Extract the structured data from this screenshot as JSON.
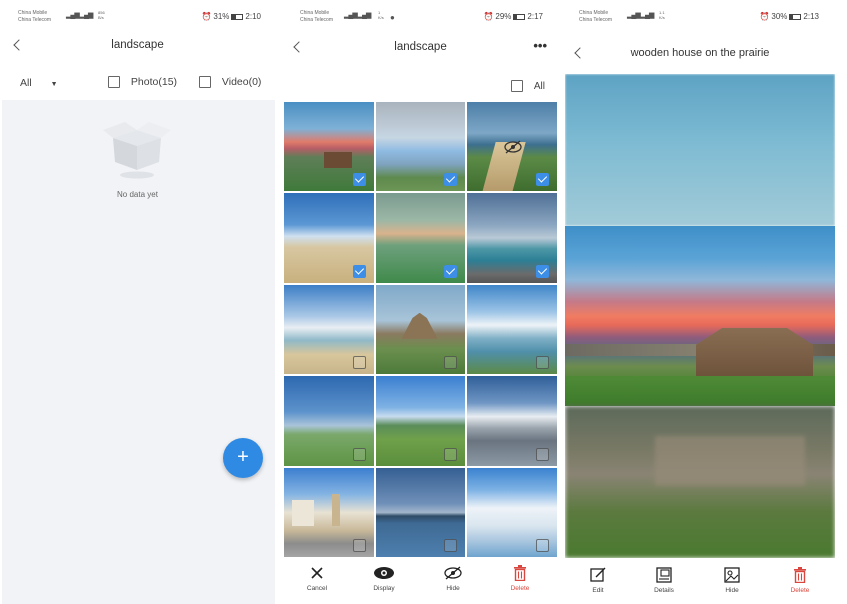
{
  "screen1": {
    "status": {
      "carrier_1": "China Mobile",
      "carrier_2": "China Telecom",
      "speed": "856",
      "speed_unit": "B/s",
      "battery": "31%",
      "battery_level": 0.31,
      "time": "2:10"
    },
    "title": "landscape",
    "filter": {
      "all_label": "All",
      "photo_label": "Photo(15)",
      "video_label": "Video(0)"
    },
    "empty_text": "No data yet",
    "fab_label": "+"
  },
  "screen2": {
    "status": {
      "carrier_1": "China Mobile",
      "carrier_2": "China Telecom",
      "speed": "1",
      "speed_unit": "K/s",
      "battery": "29%",
      "battery_level": 0.29,
      "time": "2:17"
    },
    "title": "landscape",
    "select_all_label": "All",
    "thumbnails": [
      {
        "subject": "prairie-sunset-wooden-house",
        "selected": true
      },
      {
        "subject": "blurred-sky",
        "selected": true
      },
      {
        "subject": "coastal-path",
        "selected": true,
        "hidden_badge": "eye-off-icon"
      },
      {
        "subject": "beach-dunes",
        "selected": true
      },
      {
        "subject": "green-valley",
        "selected": true
      },
      {
        "subject": "rocky-coast",
        "selected": true
      },
      {
        "subject": "beach-clouds",
        "selected": false
      },
      {
        "subject": "hill-castle",
        "selected": false
      },
      {
        "subject": "lake-clouds",
        "selected": false
      },
      {
        "subject": "green-field-sky",
        "selected": false
      },
      {
        "subject": "meadow-hill",
        "selected": false
      },
      {
        "subject": "snowy-mountains",
        "selected": false
      },
      {
        "subject": "european-town",
        "selected": false
      },
      {
        "subject": "distant-island",
        "selected": false
      },
      {
        "subject": "cumulus-clouds",
        "selected": false
      }
    ],
    "actions": [
      {
        "label": "Cancel",
        "icon": "close-icon"
      },
      {
        "label": "Display",
        "icon": "eye-icon"
      },
      {
        "label": "Hide",
        "icon": "eye-off-icon"
      },
      {
        "label": "Delete",
        "icon": "trash-icon"
      }
    ]
  },
  "screen3": {
    "status": {
      "carrier_1": "China Mobile",
      "carrier_2": "China Telecom",
      "speed": "1.1",
      "speed_unit": "K/s",
      "battery": "30%",
      "battery_level": 0.3,
      "time": "2:13"
    },
    "title": "wooden house on the prairie",
    "actions": [
      {
        "label": "Edit",
        "icon": "edit-icon"
      },
      {
        "label": "Details",
        "icon": "details-icon"
      },
      {
        "label": "Hide",
        "icon": "hide-image-icon"
      },
      {
        "label": "Delete",
        "icon": "trash-icon"
      }
    ]
  },
  "colors": {
    "accent": "#2f8ae3",
    "delete": "#d9473e",
    "empty_bg": "#f1f3f6"
  }
}
